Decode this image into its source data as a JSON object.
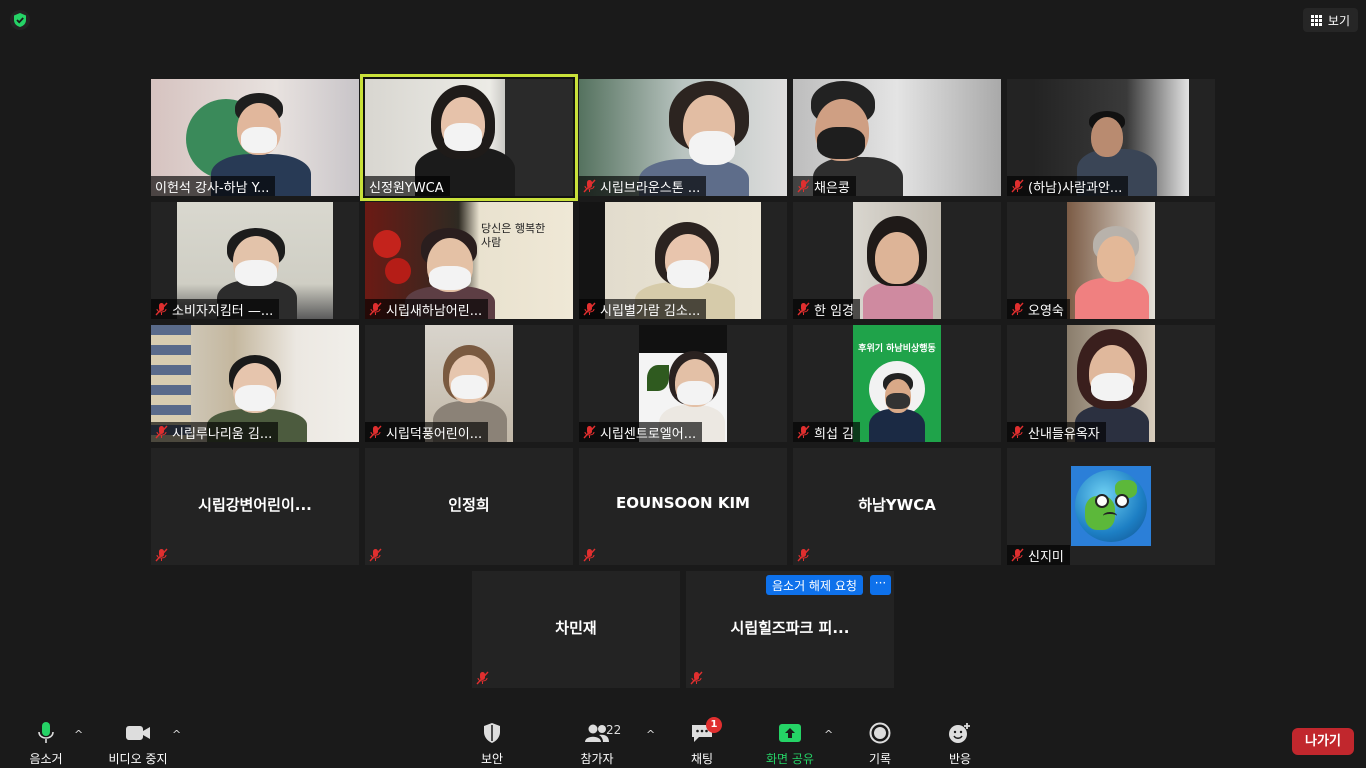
{
  "top": {
    "view_label": "보기"
  },
  "tiles": [
    "이헌석 강사-하남 Y...",
    "신정원YWCA",
    "시립브라운스톤 ...",
    "채은콩",
    "(하남)사람과안...",
    "소비자지킴터 —...",
    "시립새하남어린...",
    "시립별가람 김소...",
    "한 임경",
    "오영숙",
    "시립루나리움 김...",
    "시립덕풍어린이...",
    "시립센트로엘어...",
    "희섭 김",
    "산내들유옥자",
    "시립강변어린이...",
    "인정희",
    "EOUNSOON KIM",
    "하남YWCA",
    "신지미",
    "차민재",
    "시립힐즈파크 피..."
  ],
  "tile_extra": {
    "green_banner": "후위기 하남비상행동",
    "handwriting": "당신은 행복한 사람"
  },
  "unmute_request": "음소거 해제 요청",
  "more_label": "···",
  "toolbar": {
    "mute": "음소거",
    "video": "비디오 중지",
    "security": "보안",
    "participants": "참가자",
    "participants_count": "22",
    "chat": "채팅",
    "chat_badge": "1",
    "share": "화면 공유",
    "record": "기록",
    "reactions": "반응",
    "leave": "나가기"
  },
  "colors": {
    "active_speaker": "#c9e13a",
    "share_green": "#25d366",
    "leave_red": "#c1272d",
    "request_blue": "#0e71eb"
  }
}
